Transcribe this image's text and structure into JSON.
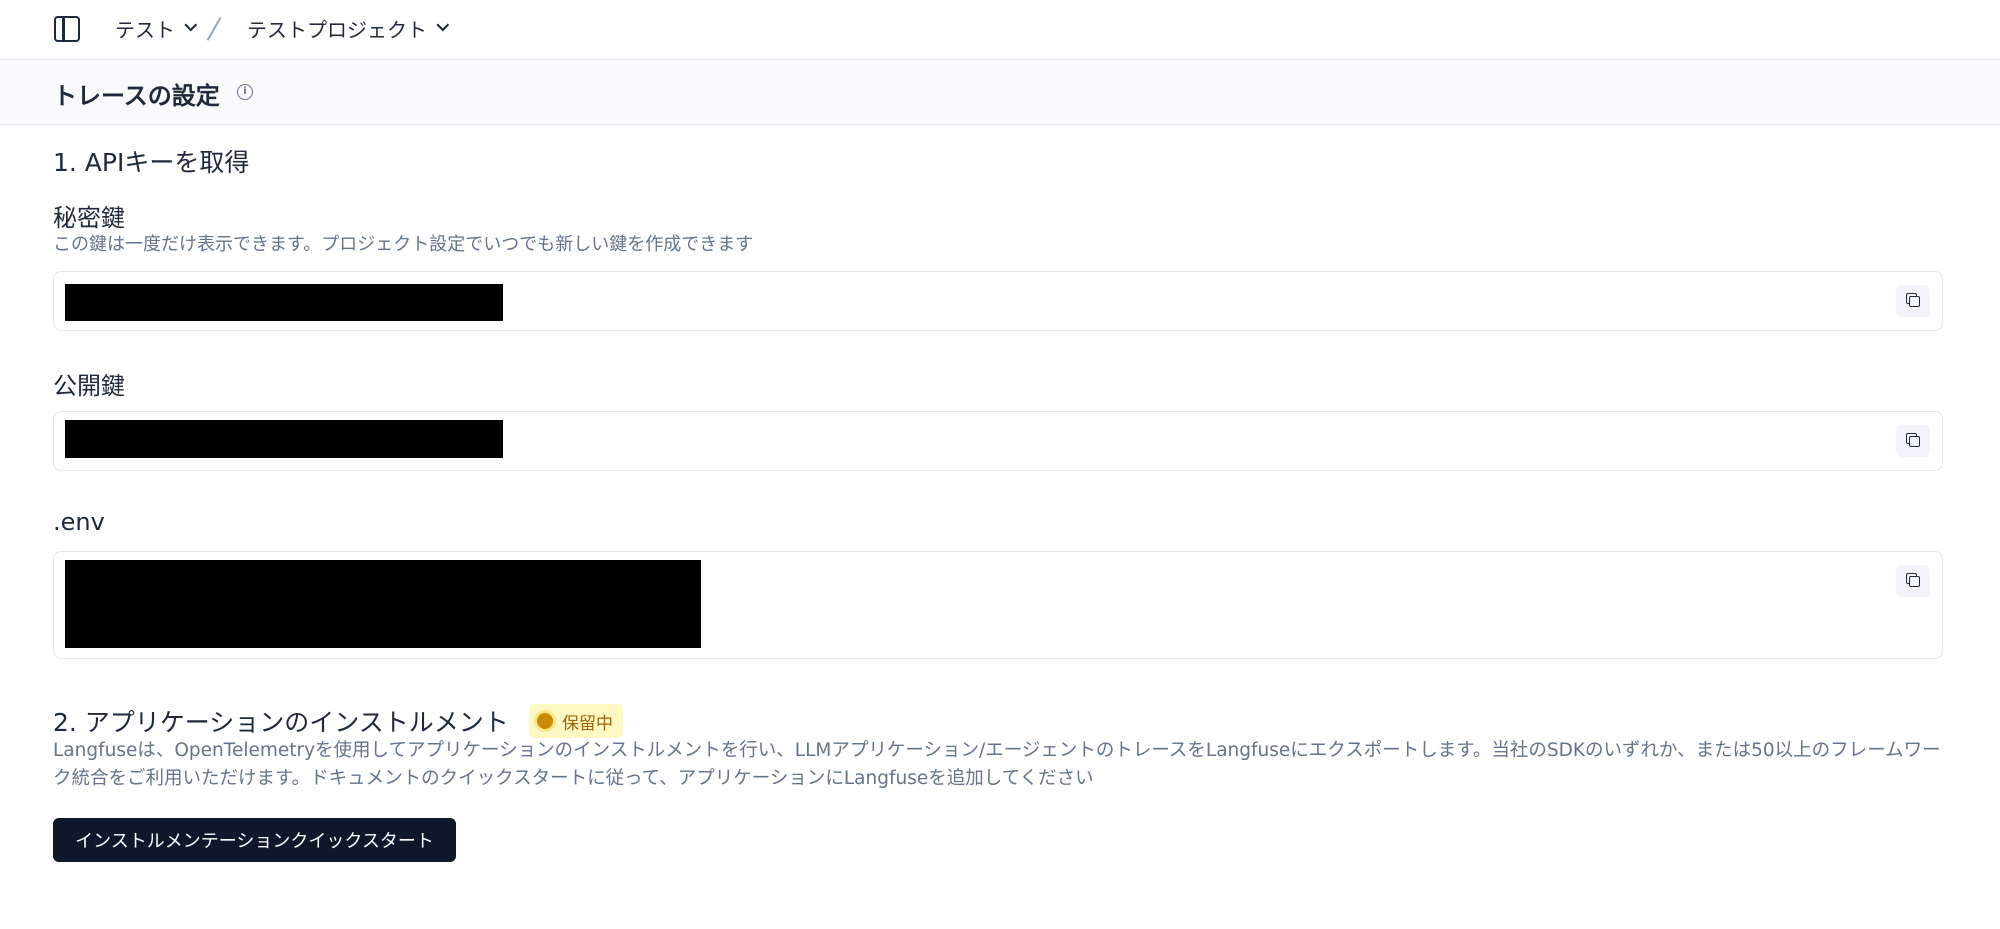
{
  "topbar": {
    "breadcrumb": [
      {
        "label": "テスト"
      },
      {
        "label": "テストプロジェクト"
      }
    ]
  },
  "header": {
    "title": "トレースの設定"
  },
  "step1": {
    "title": "1. APIキーを取得",
    "secret_key": {
      "label": "秘密鍵",
      "description": "この鍵は一度だけ表示できます。プロジェクト設定でいつでも新しい鍵を作成できます"
    },
    "public_key": {
      "label": "公開鍵"
    },
    "env": {
      "label": ".env"
    }
  },
  "step2": {
    "title": "2. アプリケーションのインストルメント",
    "status_badge": "保留中",
    "description_line1": "Langfuseは、OpenTelemetryを使用してアプリケーションのインストルメントを行い、LLMアプリケーション/エージェントのトレースをLangfuseにエクスポートします。当社のSDKのいずれか、または50以上のフレームワー",
    "description_line2": "ク統合をご利用いただけます。ドキュメントのクイックスタートに従って、アプリケーションにLangfuseを追加してください",
    "button_label": "インストルメンテーションクイックスタート"
  },
  "colors": {
    "primary_button": "#0f172a",
    "badge_bg": "#fef9c3",
    "badge_text": "#a16207",
    "muted_text": "#64748b"
  }
}
